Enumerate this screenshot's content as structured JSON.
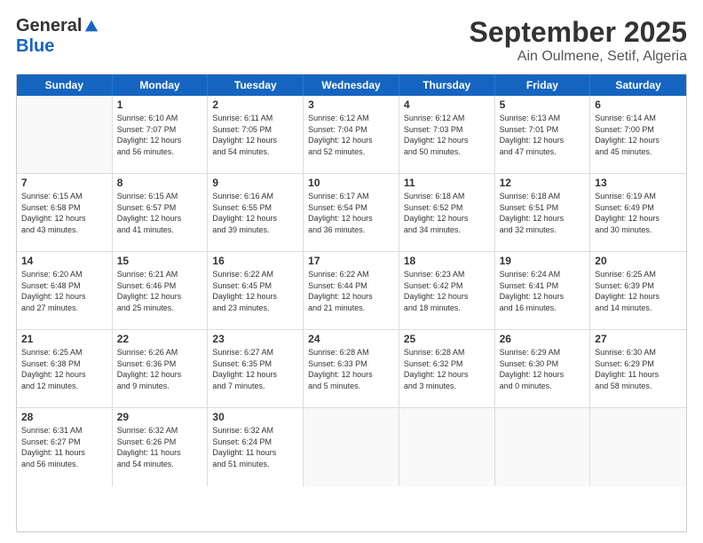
{
  "logo": {
    "general": "General",
    "blue": "Blue"
  },
  "title": "September 2025",
  "subtitle": "Ain Oulmene, Setif, Algeria",
  "header_days": [
    "Sunday",
    "Monday",
    "Tuesday",
    "Wednesday",
    "Thursday",
    "Friday",
    "Saturday"
  ],
  "weeks": [
    [
      {
        "day": "",
        "info": ""
      },
      {
        "day": "1",
        "info": "Sunrise: 6:10 AM\nSunset: 7:07 PM\nDaylight: 12 hours\nand 56 minutes."
      },
      {
        "day": "2",
        "info": "Sunrise: 6:11 AM\nSunset: 7:05 PM\nDaylight: 12 hours\nand 54 minutes."
      },
      {
        "day": "3",
        "info": "Sunrise: 6:12 AM\nSunset: 7:04 PM\nDaylight: 12 hours\nand 52 minutes."
      },
      {
        "day": "4",
        "info": "Sunrise: 6:12 AM\nSunset: 7:03 PM\nDaylight: 12 hours\nand 50 minutes."
      },
      {
        "day": "5",
        "info": "Sunrise: 6:13 AM\nSunset: 7:01 PM\nDaylight: 12 hours\nand 47 minutes."
      },
      {
        "day": "6",
        "info": "Sunrise: 6:14 AM\nSunset: 7:00 PM\nDaylight: 12 hours\nand 45 minutes."
      }
    ],
    [
      {
        "day": "7",
        "info": "Sunrise: 6:15 AM\nSunset: 6:58 PM\nDaylight: 12 hours\nand 43 minutes."
      },
      {
        "day": "8",
        "info": "Sunrise: 6:15 AM\nSunset: 6:57 PM\nDaylight: 12 hours\nand 41 minutes."
      },
      {
        "day": "9",
        "info": "Sunrise: 6:16 AM\nSunset: 6:55 PM\nDaylight: 12 hours\nand 39 minutes."
      },
      {
        "day": "10",
        "info": "Sunrise: 6:17 AM\nSunset: 6:54 PM\nDaylight: 12 hours\nand 36 minutes."
      },
      {
        "day": "11",
        "info": "Sunrise: 6:18 AM\nSunset: 6:52 PM\nDaylight: 12 hours\nand 34 minutes."
      },
      {
        "day": "12",
        "info": "Sunrise: 6:18 AM\nSunset: 6:51 PM\nDaylight: 12 hours\nand 32 minutes."
      },
      {
        "day": "13",
        "info": "Sunrise: 6:19 AM\nSunset: 6:49 PM\nDaylight: 12 hours\nand 30 minutes."
      }
    ],
    [
      {
        "day": "14",
        "info": "Sunrise: 6:20 AM\nSunset: 6:48 PM\nDaylight: 12 hours\nand 27 minutes."
      },
      {
        "day": "15",
        "info": "Sunrise: 6:21 AM\nSunset: 6:46 PM\nDaylight: 12 hours\nand 25 minutes."
      },
      {
        "day": "16",
        "info": "Sunrise: 6:22 AM\nSunset: 6:45 PM\nDaylight: 12 hours\nand 23 minutes."
      },
      {
        "day": "17",
        "info": "Sunrise: 6:22 AM\nSunset: 6:44 PM\nDaylight: 12 hours\nand 21 minutes."
      },
      {
        "day": "18",
        "info": "Sunrise: 6:23 AM\nSunset: 6:42 PM\nDaylight: 12 hours\nand 18 minutes."
      },
      {
        "day": "19",
        "info": "Sunrise: 6:24 AM\nSunset: 6:41 PM\nDaylight: 12 hours\nand 16 minutes."
      },
      {
        "day": "20",
        "info": "Sunrise: 6:25 AM\nSunset: 6:39 PM\nDaylight: 12 hours\nand 14 minutes."
      }
    ],
    [
      {
        "day": "21",
        "info": "Sunrise: 6:25 AM\nSunset: 6:38 PM\nDaylight: 12 hours\nand 12 minutes."
      },
      {
        "day": "22",
        "info": "Sunrise: 6:26 AM\nSunset: 6:36 PM\nDaylight: 12 hours\nand 9 minutes."
      },
      {
        "day": "23",
        "info": "Sunrise: 6:27 AM\nSunset: 6:35 PM\nDaylight: 12 hours\nand 7 minutes."
      },
      {
        "day": "24",
        "info": "Sunrise: 6:28 AM\nSunset: 6:33 PM\nDaylight: 12 hours\nand 5 minutes."
      },
      {
        "day": "25",
        "info": "Sunrise: 6:28 AM\nSunset: 6:32 PM\nDaylight: 12 hours\nand 3 minutes."
      },
      {
        "day": "26",
        "info": "Sunrise: 6:29 AM\nSunset: 6:30 PM\nDaylight: 12 hours\nand 0 minutes."
      },
      {
        "day": "27",
        "info": "Sunrise: 6:30 AM\nSunset: 6:29 PM\nDaylight: 11 hours\nand 58 minutes."
      }
    ],
    [
      {
        "day": "28",
        "info": "Sunrise: 6:31 AM\nSunset: 6:27 PM\nDaylight: 11 hours\nand 56 minutes."
      },
      {
        "day": "29",
        "info": "Sunrise: 6:32 AM\nSunset: 6:26 PM\nDaylight: 11 hours\nand 54 minutes."
      },
      {
        "day": "30",
        "info": "Sunrise: 6:32 AM\nSunset: 6:24 PM\nDaylight: 11 hours\nand 51 minutes."
      },
      {
        "day": "",
        "info": ""
      },
      {
        "day": "",
        "info": ""
      },
      {
        "day": "",
        "info": ""
      },
      {
        "day": "",
        "info": ""
      }
    ]
  ]
}
